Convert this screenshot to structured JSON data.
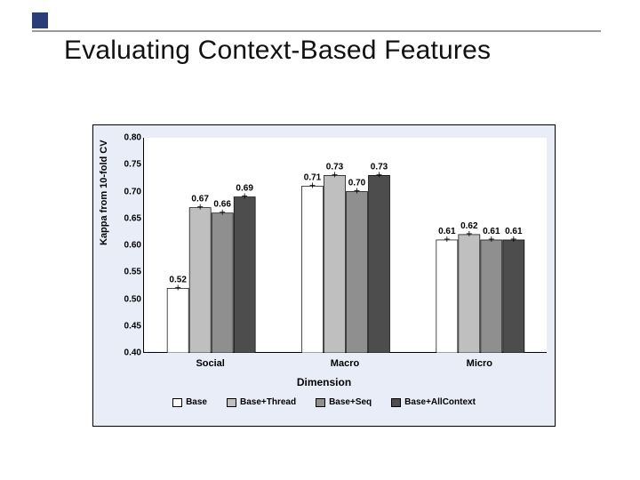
{
  "slide": {
    "title": "Evaluating Context-Based Features"
  },
  "chart_data": {
    "type": "bar",
    "title": "",
    "xlabel": "Dimension",
    "ylabel": "Kappa from 10-fold CV",
    "ylim": [
      0.4,
      0.8
    ],
    "yticks": [
      0.4,
      0.45,
      0.5,
      0.55,
      0.6,
      0.65,
      0.7,
      0.75,
      0.8
    ],
    "ytick_labels": [
      "0.40",
      "0.45",
      "0.50",
      "0.55",
      "0.60",
      "0.65",
      "0.70",
      "0.75",
      "0.80"
    ],
    "categories": [
      "Social",
      "Macro",
      "Micro"
    ],
    "series": [
      {
        "name": "Base",
        "color": "#ffffff",
        "values": [
          0.52,
          0.71,
          0.61
        ]
      },
      {
        "name": "Base+Thread",
        "color": "#bfbfbf",
        "values": [
          0.67,
          0.73,
          0.62
        ]
      },
      {
        "name": "Base+Seq",
        "color": "#8f8f8f",
        "values": [
          0.66,
          0.7,
          0.61
        ]
      },
      {
        "name": "Base+AllContext",
        "color": "#4d4d4d",
        "values": [
          0.69,
          0.73,
          0.61
        ]
      }
    ],
    "value_labels": [
      [
        "0.52",
        "0.67",
        "0.66",
        "0.69"
      ],
      [
        "0.71",
        "0.73",
        "0.70",
        "0.73"
      ],
      [
        "0.61",
        "0.62",
        "0.61",
        "0.61"
      ]
    ],
    "legend_position": "bottom",
    "grid": true
  }
}
